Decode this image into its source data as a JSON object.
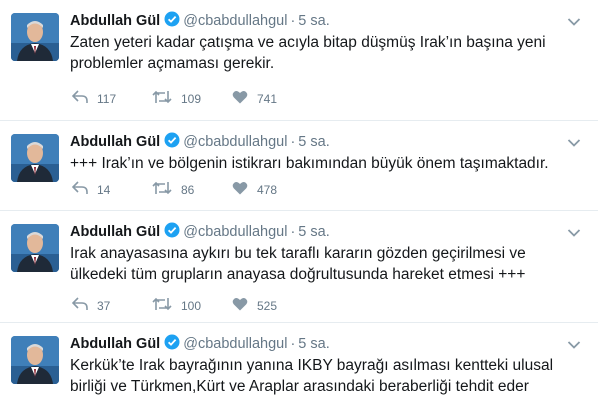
{
  "icons": {
    "reply": "reply-icon",
    "retweet": "retweet-icon",
    "like": "heart-icon",
    "verified": "verified-badge-icon",
    "menu": "chevron-down-icon"
  },
  "colors": {
    "text": "#14171a",
    "secondary": "#657786",
    "icon": "#8899a6",
    "verified": "#1da1f2",
    "divider": "#e6ecf0"
  },
  "tweets": [
    {
      "name": "Abdullah Gül",
      "handle": "@cbabdullahgul",
      "time": "5 sa.",
      "lines": [
        "Zaten yeteri kadar çatışma ve acıyla bitap düşmüş Irak’ın başına yeni",
        "problemler açmaması gerekir."
      ],
      "replies": "117",
      "retweets": "109",
      "likes": "741"
    },
    {
      "name": "Abdullah Gül",
      "handle": "@cbabdullahgul",
      "time": "5 sa.",
      "lines": [
        "+++ Irak’ın ve bölgenin istikrarı bakımından büyük önem taşımaktadır."
      ],
      "replies": "14",
      "retweets": "86",
      "likes": "478"
    },
    {
      "name": "Abdullah Gül",
      "handle": "@cbabdullahgul",
      "time": "5 sa.",
      "lines": [
        "Irak anayasasına aykırı bu tek taraflı kararın gözden geçirilmesi ve",
        "ülkedeki tüm grupların anayasa doğrultusunda hareket etmesi +++"
      ],
      "replies": "37",
      "retweets": "100",
      "likes": "525"
    },
    {
      "name": "Abdullah Gül",
      "handle": "@cbabdullahgul",
      "time": "5 sa.",
      "lines": [
        "Kerkük’te Irak bayrağının yanına IKBY bayrağı asılması kentteki ulusal",
        "birliği ve Türkmen,Kürt ve Araplar arasındaki beraberliği tehdit eder"
      ]
    }
  ]
}
